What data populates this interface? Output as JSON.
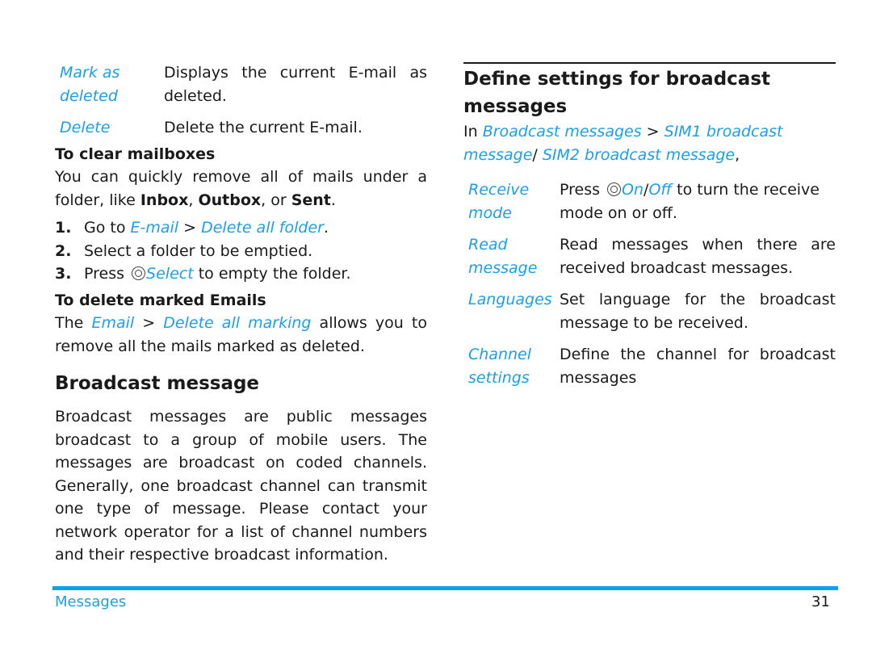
{
  "left": {
    "options": [
      {
        "term": "Mark as deleted",
        "desc": "Displays the current E-mail as deleted."
      },
      {
        "term": "Delete",
        "desc": "Delete the current E-mail."
      }
    ],
    "clear_mailboxes": {
      "heading": "To clear mailboxes",
      "intro_pre": "You can quickly remove all of mails under a folder, like ",
      "inbox": "Inbox",
      "sep1": ", ",
      "outbox": "Outbox",
      "sep2": ", or ",
      "sent": "Sent",
      "end": ".",
      "steps": [
        {
          "num": "1.",
          "pre": "Go to ",
          "link1": "E-mail",
          "mid": " > ",
          "link2": "Delete all folder",
          "post": "."
        },
        {
          "num": "2.",
          "text": "Select a folder to be emptied."
        },
        {
          "num": "3.",
          "pre": "Press ",
          "key_icon": "navigation-key-icon",
          "link": "Select",
          "post": " to empty the folder."
        }
      ]
    },
    "delete_marked": {
      "heading": "To delete marked Emails",
      "pre": "The ",
      "link1": "Email",
      "mid": " > ",
      "link2": "Delete all marking",
      "post": " allows you to remove all the mails marked as deleted."
    },
    "broadcast": {
      "heading": "Broadcast message",
      "body": "Broadcast messages are public messages broadcast to a group of mobile users. The messages are broadcast on coded channels. Generally, one broadcast channel can transmit one type of message. Please contact your network operator for a list of channel numbers and their respective broadcast information."
    }
  },
  "right": {
    "heading": "Define settings for broadcast messages",
    "path": {
      "pre": "In ",
      "link1": "Broadcast messages",
      "mid": " > ",
      "link2": "SIM1 broadcast message",
      "slash": "/ ",
      "link3": "SIM2 broadcast message",
      "post": ","
    },
    "options": [
      {
        "term": "Receive mode",
        "desc_pre": "Press ",
        "key_icon": "navigation-key-icon",
        "link1": "On",
        "slash": "/",
        "link2": "Off",
        "desc_post": " to turn the receive mode on or off."
      },
      {
        "term": "Read message",
        "desc": "Read messages when there are received broadcast messages."
      },
      {
        "term": "Languages",
        "desc": "Set language for the broadcast message to be received."
      },
      {
        "term": "Channel settings",
        "desc": "Define the channel for broadcast messages"
      }
    ]
  },
  "footer": {
    "section": "Messages",
    "page_number": "31",
    "accent_color": "#0aa2ee"
  },
  "colors": {
    "link": "#1a9fe8",
    "text": "#1a1a1a"
  }
}
